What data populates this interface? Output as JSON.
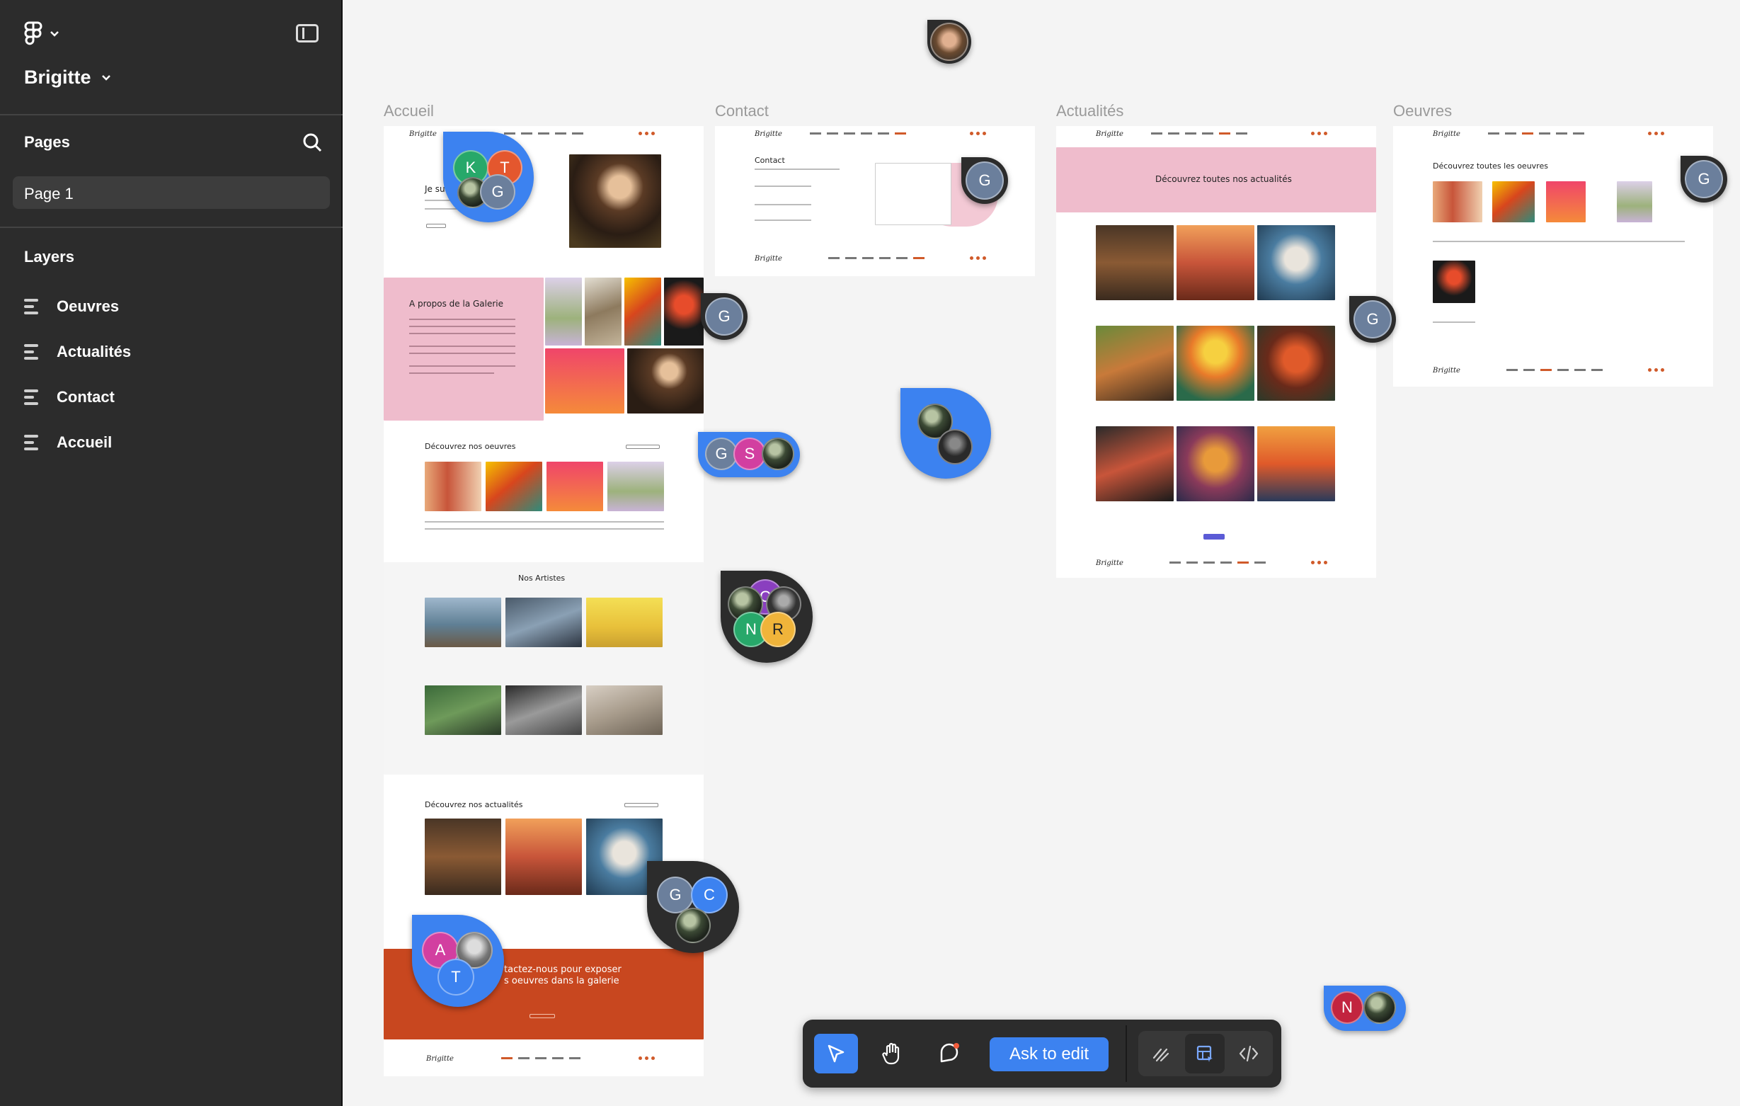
{
  "sidebar": {
    "file_name": "Brigitte",
    "pages_heading": "Pages",
    "pages": [
      "Page 1"
    ],
    "layers_heading": "Layers",
    "layers": [
      "Oeuvres",
      "Actualités",
      "Contact",
      "Accueil"
    ]
  },
  "canvas": {
    "frames": {
      "accueil": "Accueil",
      "contact": "Contact",
      "actualites": "Actualités",
      "oeuvres": "Oeuvres"
    },
    "accueil": {
      "about_title": "A propos de la Galerie",
      "oeuvres_title": "Découvrez nos oeuvres",
      "artists_title": "Nos Artistes",
      "news_title": "Découvrez nos actualités",
      "cta_line1": "tactez-nous pour exposer",
      "cta_line2": "s oeuvres dans la galerie"
    },
    "contact": {
      "title": "Contact"
    },
    "actualites": {
      "banner": "Découvrez toutes nos actualités"
    },
    "oeuvres": {
      "title": "Découvrez toutes les oeuvres"
    }
  },
  "avatars": {
    "group1": [
      "K",
      "T",
      "G"
    ],
    "g_single": "G",
    "group_gs": [
      "G",
      "S"
    ],
    "group_cnr": [
      "C",
      "N",
      "R"
    ],
    "group_gc": [
      "G",
      "C"
    ],
    "group_at": [
      "A",
      "T"
    ],
    "n_single": "N"
  },
  "toolbar": {
    "ask_label": "Ask to edit"
  },
  "colors": {
    "accent": "#3c82f0",
    "sidebar_bg": "#2c2c2c",
    "canvas_bg": "#f4f4f4",
    "brand_orange": "#c8471f",
    "brand_pink": "#efbccc"
  }
}
